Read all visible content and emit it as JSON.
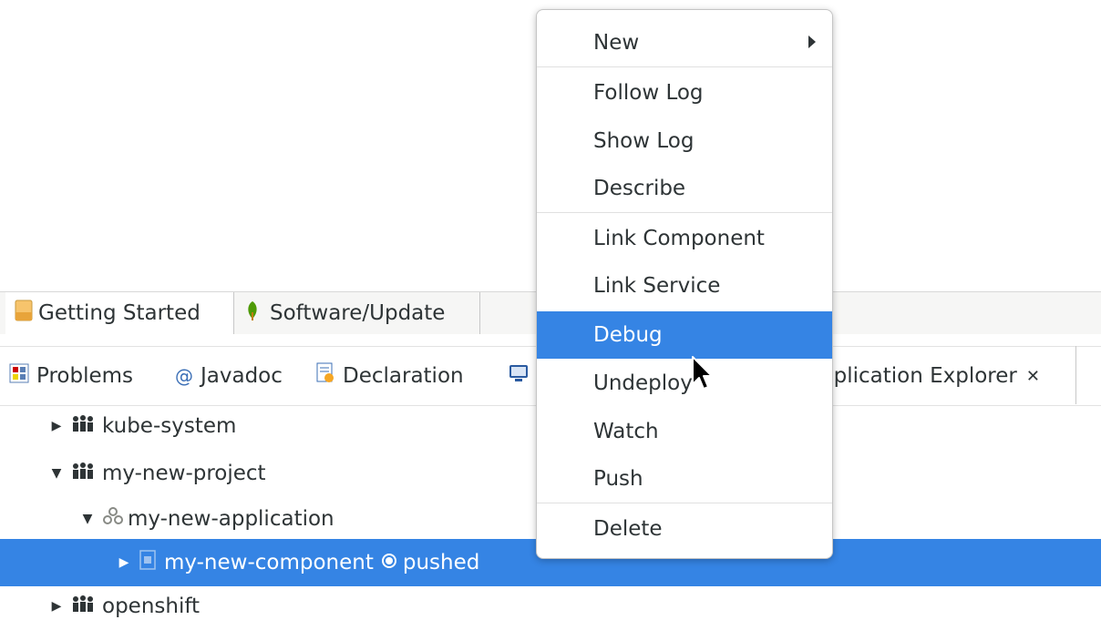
{
  "editor_tabs": [
    {
      "label": "Getting Started",
      "icon": "document-icon"
    },
    {
      "label": "Software/Update",
      "icon": "leaf-icon"
    }
  ],
  "view_tabs": [
    {
      "label": "Problems",
      "icon": "problems-icon"
    },
    {
      "label": "Javadoc",
      "icon": "at-icon"
    },
    {
      "label": "Declaration",
      "icon": "declaration-icon"
    },
    {
      "label": "",
      "icon": "console-icon"
    },
    {
      "label": "pplication Explorer",
      "icon": "close-icon"
    }
  ],
  "tree": [
    {
      "label": "kube-system",
      "expanded": false,
      "icon": "project-icon"
    },
    {
      "label": "my-new-project",
      "expanded": true,
      "icon": "project-icon"
    },
    {
      "label": "my-new-application",
      "expanded": true,
      "icon": "application-icon"
    },
    {
      "label": "my-new-component",
      "status": "pushed",
      "expanded": false,
      "icon": "component-icon",
      "selected": true
    },
    {
      "label": "openshift",
      "expanded": false,
      "icon": "project-icon"
    }
  ],
  "context_menu": {
    "items": [
      "New",
      "Follow Log",
      "Show Log",
      "Describe",
      "Link Component",
      "Link Service",
      "Debug",
      "Undeploy",
      "Watch",
      "Push",
      "Delete"
    ],
    "highlighted": "Debug"
  },
  "colors": {
    "selection": "#3584e4",
    "text": "#2e3436"
  }
}
